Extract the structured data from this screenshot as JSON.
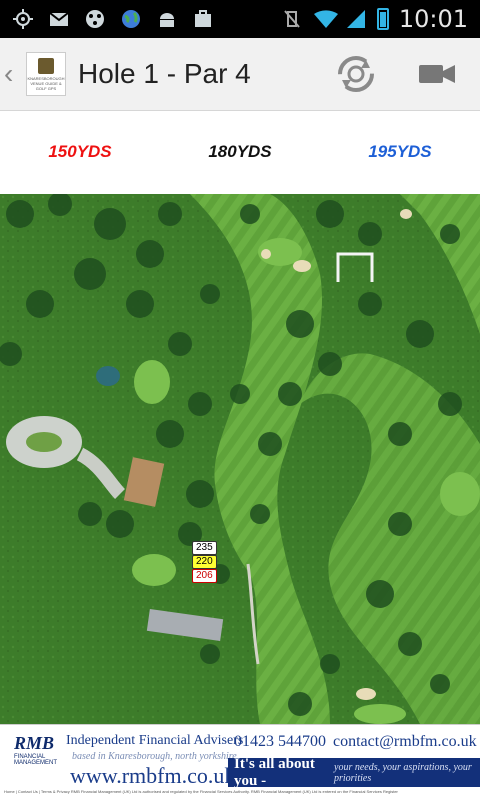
{
  "status_bar": {
    "icons": [
      "gps-icon",
      "gmail-icon",
      "app-icon",
      "globe-icon",
      "android-icon",
      "briefcase-icon"
    ],
    "time": "10:01"
  },
  "header": {
    "title": "Hole 1 - Par 4",
    "logo_text": "KNARESBOROUGH VENUE GUIDE & GOLF GPS"
  },
  "yardages": {
    "red": "150YDS",
    "black": "180YDS",
    "blue": "195YDS"
  },
  "map": {
    "distance_markers": [
      "235",
      "220",
      "206"
    ]
  },
  "ad": {
    "logo": "RMB",
    "logo_sub": "FINANCIAL MANAGEMENT",
    "tagline": "Independent Financial Advisers",
    "subline": "based in Knaresborough, north yorkshire",
    "url": "www.rmbfm.co.uk",
    "phone": "01423 544700",
    "email": "contact@rmbfm.co.uk",
    "band_main": "It's all about you -",
    "band_sub": "your needs, your aspirations, your priorities",
    "fine_print": "Home | Contact Us | Terms & Privacy  RMB Financial Management (UK) Ltd is authorised and regulated by the Financial Services Authority. RMB Financial Management (UK) Ltd is entered on the Financial Services Register"
  },
  "colors": {
    "red": "#e11111",
    "black": "#111111",
    "blue": "#1d5fd6",
    "accent": "#33b5e5"
  }
}
